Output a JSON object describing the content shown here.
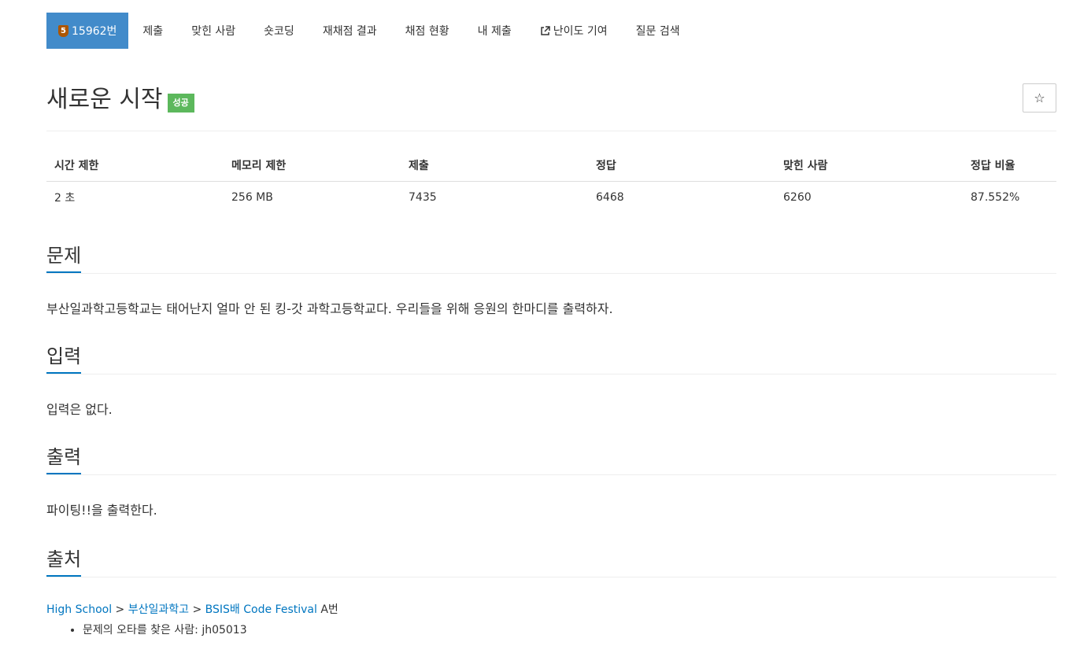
{
  "nav": {
    "problem": {
      "tier": "5",
      "number": "15962번"
    },
    "items": [
      {
        "label": "제출"
      },
      {
        "label": "맞힌 사람"
      },
      {
        "label": "숏코딩"
      },
      {
        "label": "재채점 결과"
      },
      {
        "label": "채점 현황"
      },
      {
        "label": "내 제출"
      },
      {
        "label": "난이도 기여"
      },
      {
        "label": "질문 검색"
      }
    ]
  },
  "problem": {
    "title": "새로운 시작",
    "status": "성공",
    "star": "☆"
  },
  "info": {
    "headers": [
      "시간 제한",
      "메모리 제한",
      "제출",
      "정답",
      "맞힌 사람",
      "정답 비율"
    ],
    "values": [
      "2 초",
      "256 MB",
      "7435",
      "6468",
      "6260",
      "87.552%"
    ]
  },
  "sections": {
    "description": {
      "title": "문제",
      "text": "부산일과학고등학교는 태어난지 얼마 안 된 킹-갓 과학고등학교다. 우리들을 위해 응원의 한마디를 출력하자."
    },
    "input": {
      "title": "입력",
      "text": "입력은 없다."
    },
    "output": {
      "title": "출력",
      "text": "파이팅!!을 출력한다."
    },
    "source": {
      "title": "출처",
      "link_high_school": "High School",
      "sep1": " > ",
      "link_school": "부산일과학고",
      "sep2": " > ",
      "link_festival": "BSIS배 Code Festival",
      "suffix": " A번",
      "typo_finder": "문제의 오타를 찾은 사람: jh05013"
    }
  },
  "colors": {
    "nav_active": "#428bca",
    "success_badge": "#5cb85c",
    "link": "#0076c0",
    "tier_bronze": "#ad5600"
  }
}
